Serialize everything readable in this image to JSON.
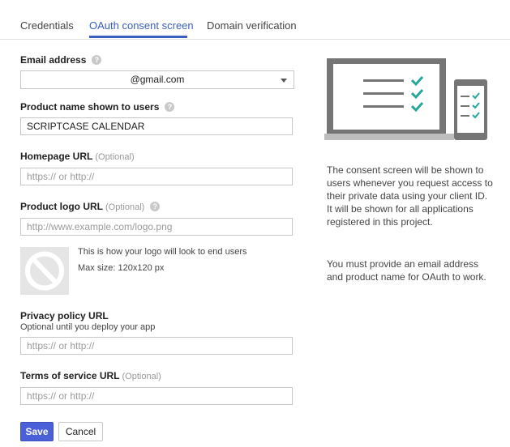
{
  "tabs": [
    "Credentials",
    "OAuth consent screen",
    "Domain verification"
  ],
  "email": {
    "label": "Email address",
    "value": "@gmail.com"
  },
  "product_name": {
    "label": "Product name shown to users",
    "value": "SCRIPTCASE CALENDAR"
  },
  "homepage": {
    "label": "Homepage URL",
    "optional": "(Optional)",
    "placeholder": "https:// or http://"
  },
  "logo_url": {
    "label": "Product logo URL",
    "optional": "(Optional)",
    "placeholder": "http://www.example.com/logo.png"
  },
  "logo_preview": {
    "line1": "This is how your logo will look to end users",
    "line2": "Max size: 120x120 px"
  },
  "privacy": {
    "label": "Privacy policy URL",
    "sublabel": "Optional until you deploy your app",
    "placeholder": "https:// or http://"
  },
  "tos": {
    "label": "Terms of service URL",
    "optional": "(Optional)",
    "placeholder": "https:// or http://"
  },
  "info": {
    "p1": "The consent screen will be shown to users whenever you request access to their private data using your client ID. It will be shown for all applications registered in this project.",
    "p2": "You must provide an email address and product name for OAuth to work."
  },
  "buttons": {
    "save": "Save",
    "cancel": "Cancel"
  },
  "help_glyph": "?",
  "icons": [
    "help-icon",
    "dropdown-caret-icon",
    "no-logo-icon",
    "laptop-phone-illustration"
  ],
  "colors": {
    "accent": "#3b5fc0",
    "primary_button": "#4a60d9",
    "check_teal": "#26a69a"
  }
}
